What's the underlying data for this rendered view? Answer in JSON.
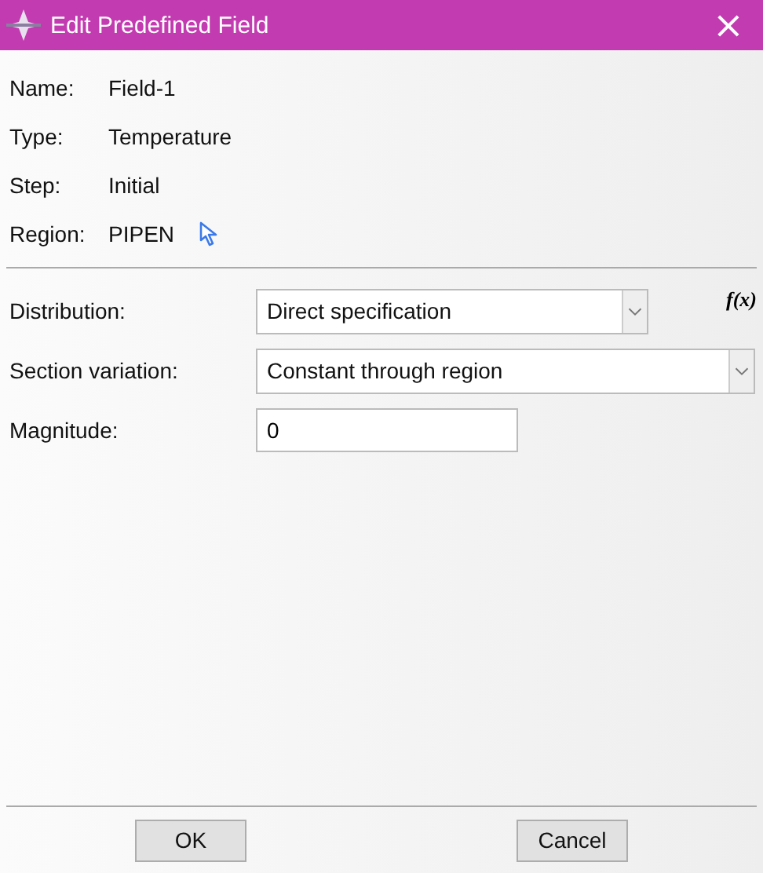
{
  "window": {
    "title": "Edit Predefined Field",
    "close": "×"
  },
  "info": [
    {
      "label": "Name:",
      "value": "Field-1"
    },
    {
      "label": "Type:",
      "value": "Temperature"
    },
    {
      "label": "Step:",
      "value": "Initial"
    },
    {
      "label": "Region:",
      "value": "PIPEN",
      "kind": "region"
    }
  ],
  "fields": [
    {
      "kind": "dropdown",
      "label": "Distribution:",
      "value": "Direct specification",
      "function": "f(x)"
    },
    {
      "kind": "dropdown",
      "label": "Section variation:",
      "value": "Constant through region"
    },
    {
      "kind": "text",
      "label": "Magnitude:",
      "value": "0"
    }
  ],
  "buttons": [
    "OK",
    "Cancel"
  ]
}
